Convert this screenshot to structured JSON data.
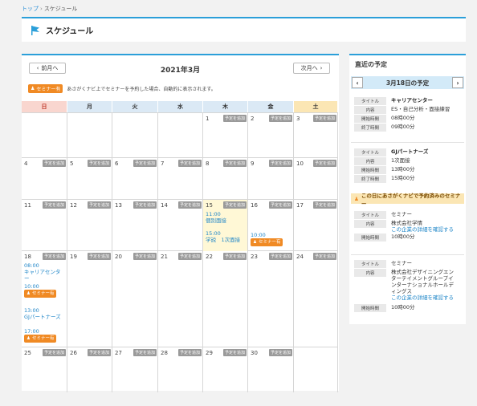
{
  "breadcrumb": {
    "home": "トップ",
    "separator": "›",
    "current": "スケジュール"
  },
  "page": {
    "title": "スケジュール"
  },
  "calendar": {
    "prev_label": "前月へ",
    "next_label": "次月へ",
    "month_title": "2021年3月",
    "seminar_badge": "セミナー有",
    "note": "あさがくナビ上でセミナーを予約した場合、自動的に表示されます。",
    "add_label": "予定を追加",
    "weekdays": [
      "日",
      "月",
      "火",
      "水",
      "木",
      "金",
      "土"
    ],
    "weeks": [
      [
        "",
        "",
        "",
        "",
        "1",
        "2",
        "3"
      ],
      [
        "4",
        "5",
        "6",
        "7",
        "8",
        "9",
        "10"
      ],
      [
        "11",
        "12",
        "13",
        "14",
        "15",
        "16",
        "17"
      ],
      [
        "18",
        "19",
        "20",
        "21",
        "22",
        "23",
        "24"
      ],
      [
        "25",
        "26",
        "27",
        "28",
        "29",
        "30",
        ""
      ]
    ],
    "events": {
      "d15": {
        "e1_time": "11:00",
        "e1_title": "個別面接",
        "e2_time": "15:00",
        "e2_title": "学説　1次面接"
      },
      "d16": {
        "time": "10:00",
        "badge": "セミナー有"
      },
      "d18": {
        "e1_time": "08:00",
        "e1_title": "キャリアセンター",
        "e2_time": "10:00",
        "e2_badge": "セミナー有",
        "e3_time": "13:00",
        "e3_title": "GJパートナーズ",
        "e4_time": "17:00",
        "e4_badge": "セミナー有"
      }
    }
  },
  "side": {
    "title": "直近の予定",
    "date_label": "3月18日の予定",
    "labels": {
      "title": "タイトル",
      "content": "内容",
      "start": "開始時間",
      "end": "終了時間"
    },
    "items": [
      {
        "title": "キャリアセンター",
        "content": "ES・自己分析・面接練習",
        "start": "08時00分",
        "end": "09時00分"
      },
      {
        "title": "GJパートナーズ",
        "content": "1次面接",
        "start": "13時00分",
        "end": "15時00分"
      }
    ],
    "seminar_header": "この日にあさがくナビで予約済みのセミナー",
    "seminars": [
      {
        "title": "セミナー",
        "content": "株式会社学情",
        "link": "この企業の詳細を確認する",
        "start": "10時00分"
      },
      {
        "title": "セミナー",
        "content": "株式会社デザイニングエンターテイメントグループインターナショナルホールディングス",
        "link": "この企業の詳細を確認する",
        "start": "10時00分"
      }
    ]
  },
  "colors": {
    "accent": "#2b9fd9",
    "seminar": "#f08a24",
    "today": "#fff8d6",
    "sunday": "#f9d6cf",
    "saturday": "#fbe6b4",
    "weekday": "#dbe9f5"
  }
}
